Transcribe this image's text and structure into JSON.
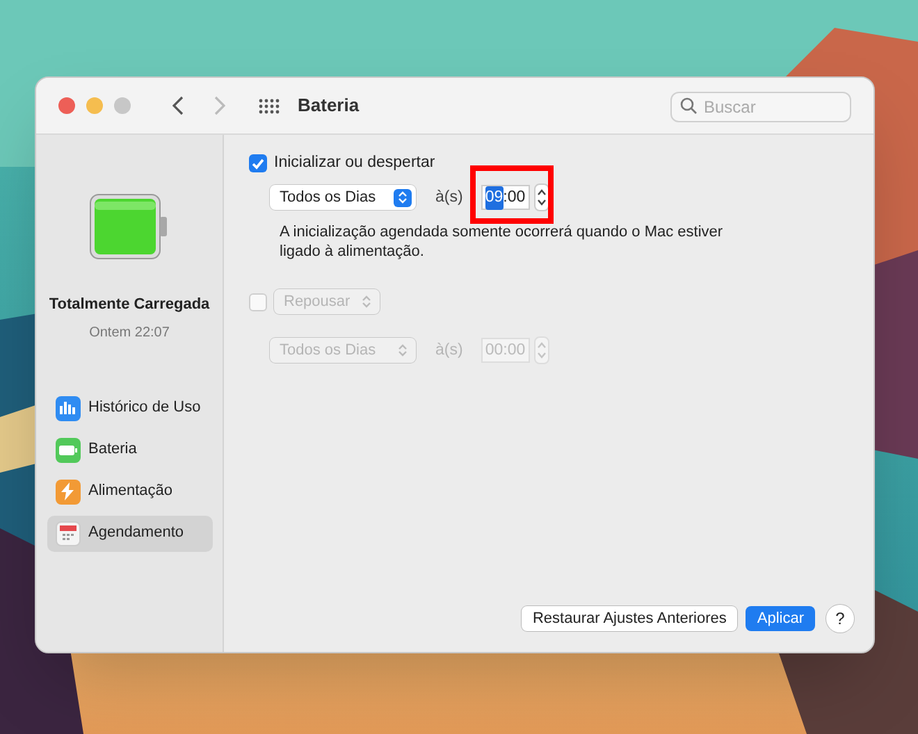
{
  "window": {
    "title": "Bateria"
  },
  "search": {
    "placeholder": "Buscar"
  },
  "battery": {
    "level": 1,
    "status": "Totalmente Carregada",
    "time": "Ontem 22:07"
  },
  "sidebar": {
    "items": [
      {
        "label": "Histórico de Uso",
        "kind": "usage",
        "selected": false
      },
      {
        "label": "Bateria",
        "kind": "battery",
        "selected": false
      },
      {
        "label": "Alimentação",
        "kind": "power",
        "selected": false
      },
      {
        "label": "Agendamento",
        "kind": "schedule",
        "selected": true
      }
    ]
  },
  "schedules": [
    {
      "kind": "label",
      "action": "Inicializar ou despertar",
      "checked": true,
      "disabled": false,
      "days": "Todos os Dias",
      "at": "à(s)",
      "hour": "09",
      "separator": ":",
      "minute": "00",
      "hour_selected": true,
      "highlighted": true,
      "note": "A inicialização agendada somente ocorrerá quando o Mac estiver ligado à alimentação."
    },
    {
      "kind": "popup",
      "action": "Repousar",
      "checked": false,
      "disabled": true,
      "days": "Todos os Dias",
      "at": "à(s)",
      "hour": "00",
      "separator": ":",
      "minute": "00",
      "hour_selected": false,
      "highlighted": false
    }
  ],
  "buttons": [
    {
      "label": "Restaurar Ajustes Anteriores",
      "kind": "default"
    },
    {
      "label": "Aplicar",
      "kind": "primary"
    }
  ],
  "help": "?"
}
